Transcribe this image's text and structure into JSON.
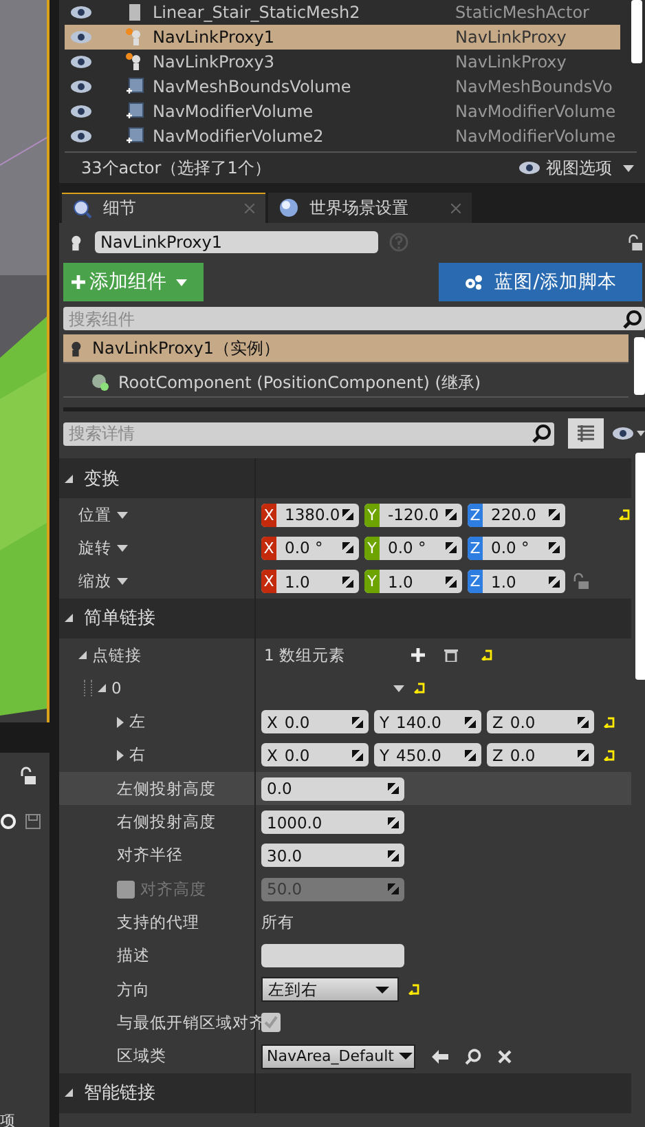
{
  "outliner": {
    "rows": [
      {
        "name": "Linear_Stair_StaticMesh2",
        "type": "StaticMeshActor",
        "kind": "mesh",
        "selected": false
      },
      {
        "name": "NavLinkProxy1",
        "type": "NavLinkProxy",
        "kind": "proxy",
        "selected": true
      },
      {
        "name": "NavLinkProxy3",
        "type": "NavLinkProxy",
        "kind": "proxy",
        "selected": false
      },
      {
        "name": "NavMeshBoundsVolume",
        "type": "NavMeshBoundsVo",
        "kind": "volume",
        "selected": false
      },
      {
        "name": "NavModifierVolume",
        "type": "NavModifierVolume",
        "kind": "volume",
        "selected": false
      },
      {
        "name": "NavModifierVolume2",
        "type": "NavModifierVolume",
        "kind": "volume",
        "selected": false
      }
    ],
    "summary": "33个actor（选择了1个）",
    "view_options": "视图选项"
  },
  "side_panel": {
    "label": "项"
  },
  "tabs": [
    {
      "label": "细节",
      "selected": true
    },
    {
      "label": "世界场景设置",
      "selected": false
    }
  ],
  "actor_name": "NavLinkProxy1",
  "add_component": "添加组件",
  "blueprint": "蓝图/添加脚本",
  "component_search": {
    "placeholder": "搜索组件"
  },
  "components": [
    {
      "label": "NavLinkProxy1（实例）",
      "selected": true
    },
    {
      "label": "RootComponent (PositionComponent) (继承)",
      "selected": false
    }
  ],
  "details_search": {
    "placeholder": "搜索详情"
  },
  "sections": [
    {
      "title": "变换",
      "expanded": true,
      "rows": [
        {
          "kind": "transform",
          "label": "位置",
          "reset": true,
          "axes": [
            {
              "axis": "X",
              "value": "1380.0",
              "color": "#c42a0c"
            },
            {
              "axis": "Y",
              "value": "-120.0",
              "color": "#6ea400"
            },
            {
              "axis": "Z",
              "value": "220.0",
              "color": "#2e7de0"
            }
          ]
        },
        {
          "kind": "transform",
          "label": "旋转",
          "reset": false,
          "axes": [
            {
              "axis": "X",
              "value": "0.0 °",
              "color": "#c42a0c"
            },
            {
              "axis": "Y",
              "value": "0.0 °",
              "color": "#6ea400"
            },
            {
              "axis": "Z",
              "value": "0.0 °",
              "color": "#2e7de0"
            }
          ]
        },
        {
          "kind": "transform",
          "label": "缩放",
          "reset": false,
          "locked": false,
          "axes": [
            {
              "axis": "X",
              "value": "1.0",
              "color": "#c42a0c"
            },
            {
              "axis": "Y",
              "value": "1.0",
              "color": "#6ea400"
            },
            {
              "axis": "Z",
              "value": "1.0",
              "color": "#2e7de0"
            }
          ]
        }
      ]
    },
    {
      "title": "简单链接",
      "expanded": true,
      "rows": [
        {
          "kind": "array",
          "label": "点链接",
          "value": "1 数组元素",
          "reset": true,
          "expanded": true,
          "children": [
            {
              "kind": "element",
              "label": "0",
              "reset": true,
              "expanded": true,
              "children": [
                {
                  "kind": "vector",
                  "label": "左",
                  "reset": true,
                  "expanded": false,
                  "highlighted": false,
                  "axes": [
                    {
                      "axis": "X",
                      "value": "0.0"
                    },
                    {
                      "axis": "Y",
                      "value": "140.0"
                    },
                    {
                      "axis": "Z",
                      "value": "0.0"
                    }
                  ]
                },
                {
                  "kind": "vector",
                  "label": "右",
                  "reset": true,
                  "expanded": false,
                  "highlighted": false,
                  "axes": [
                    {
                      "axis": "X",
                      "value": "0.0"
                    },
                    {
                      "axis": "Y",
                      "value": "450.0"
                    },
                    {
                      "axis": "Z",
                      "value": "0.0"
                    }
                  ]
                },
                {
                  "kind": "float",
                  "label": "左侧投射高度",
                  "value": "0.0",
                  "reset": false,
                  "highlighted": true
                },
                {
                  "kind": "float",
                  "label": "右侧投射高度",
                  "value": "1000.0",
                  "reset": false,
                  "highlighted": false
                },
                {
                  "kind": "float",
                  "label": "对齐半径",
                  "value": "30.0",
                  "reset": false,
                  "highlighted": false
                },
                {
                  "kind": "checkbox-float",
                  "label": "对齐高度",
                  "value": "50.0",
                  "checked": false,
                  "disabled": true,
                  "reset": false,
                  "highlighted": false
                },
                {
                  "kind": "text",
                  "label": "支持的代理",
                  "value": "所有",
                  "reset": false,
                  "highlighted": false
                },
                {
                  "kind": "text-field",
                  "label": "描述",
                  "reset": false,
                  "highlighted": false
                },
                {
                  "kind": "dropdown",
                  "label": "方向",
                  "value": "左到右",
                  "reset": true,
                  "highlighted": false
                },
                {
                  "kind": "checkbox",
                  "label": "与最低开销区域对齐",
                  "checked": true,
                  "disabled": true,
                  "reset": false,
                  "highlighted": false
                },
                {
                  "kind": "class-picker",
                  "label": "区域类",
                  "value": "NavArea_Default",
                  "reset": false,
                  "highlighted": false
                }
              ]
            }
          ]
        }
      ]
    },
    {
      "title": "智能链接",
      "expanded": true
    }
  ]
}
